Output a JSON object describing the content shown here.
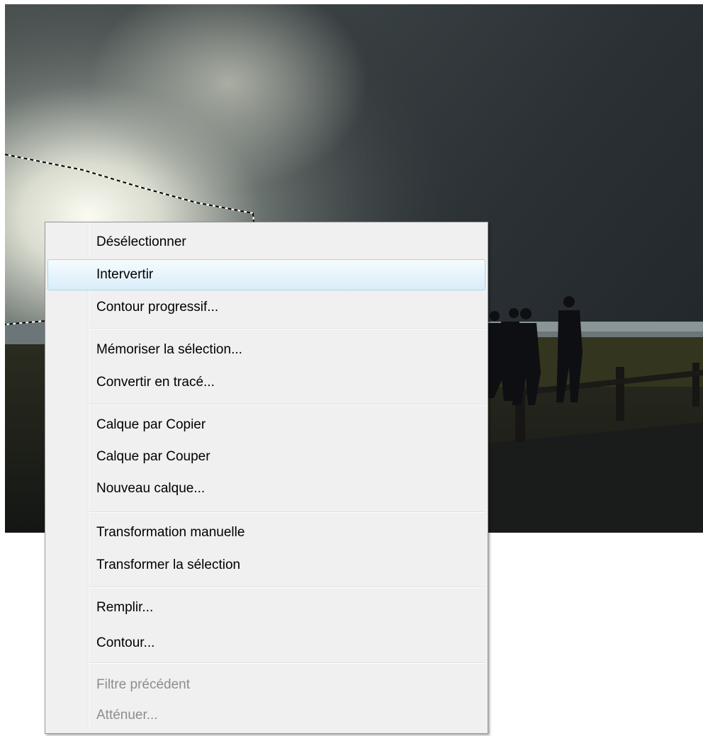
{
  "menu": {
    "items": [
      {
        "label": "Désélectionner",
        "enabled": true,
        "hovered": false
      },
      {
        "label": "Intervertir",
        "enabled": true,
        "hovered": true
      },
      {
        "label": "Contour progressif...",
        "enabled": true,
        "hovered": false
      },
      {
        "label": "Mémoriser la sélection...",
        "enabled": true,
        "hovered": false
      },
      {
        "label": "Convertir en tracé...",
        "enabled": true,
        "hovered": false
      },
      {
        "label": "Calque par Copier",
        "enabled": true,
        "hovered": false
      },
      {
        "label": "Calque par Couper",
        "enabled": true,
        "hovered": false
      },
      {
        "label": "Nouveau calque...",
        "enabled": true,
        "hovered": false
      },
      {
        "label": "Transformation manuelle",
        "enabled": true,
        "hovered": false
      },
      {
        "label": "Transformer la sélection",
        "enabled": true,
        "hovered": false
      },
      {
        "label": "Remplir...",
        "enabled": true,
        "hovered": false
      },
      {
        "label": "Contour...",
        "enabled": true,
        "hovered": false
      },
      {
        "label": "Filtre précédent",
        "enabled": false,
        "hovered": false
      },
      {
        "label": "Atténuer...",
        "enabled": false,
        "hovered": false
      }
    ]
  },
  "colors": {
    "menu_background": "#f0f0f0",
    "menu_border": "#979797",
    "hover_border": "#a8d8eb",
    "disabled_text": "#8d8d8d"
  }
}
